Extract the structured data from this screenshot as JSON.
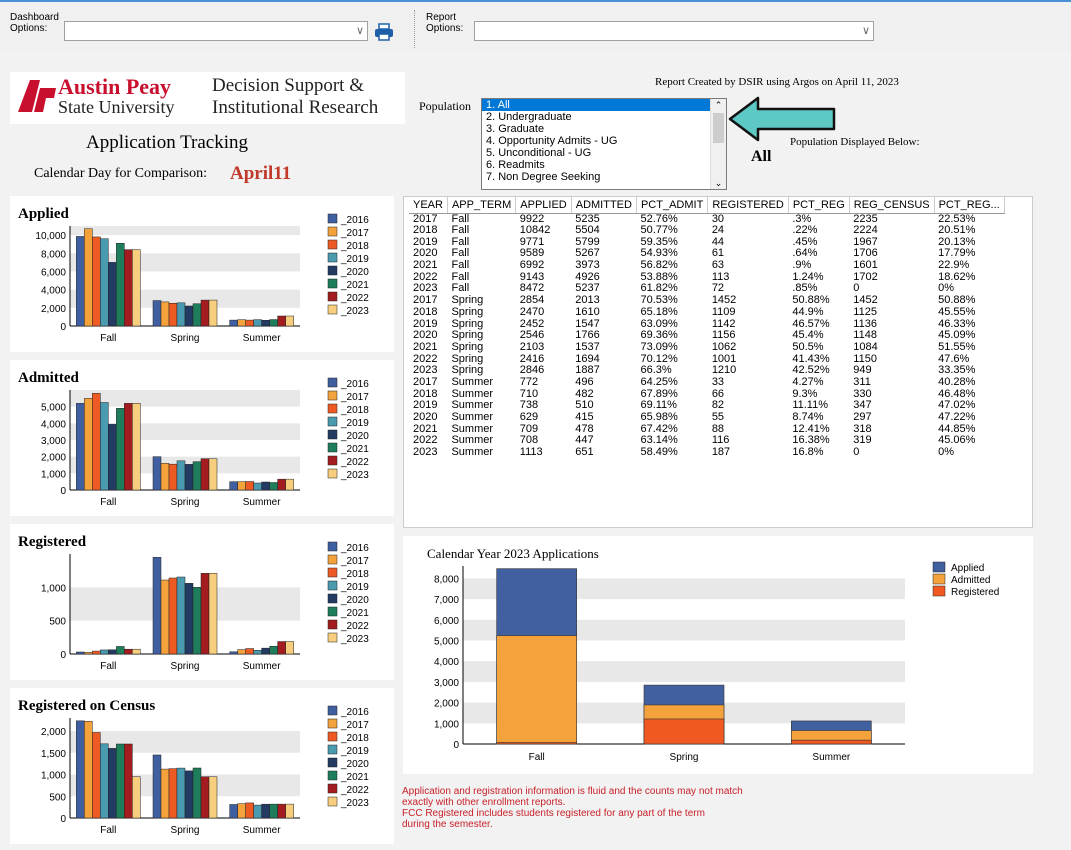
{
  "toolbar": {
    "dashboard_label_line1": "Dashboard",
    "dashboard_label_line2": "Options:",
    "report_label_line1": "Report",
    "report_label_line2": "Options:",
    "dashboard_value": "",
    "report_value": ""
  },
  "header": {
    "logo_austin": "Austin Peay",
    "logo_state": "State University",
    "logo_dept_line1": "Decision Support &",
    "logo_dept_line2": "Institutional Research",
    "title": "Application Tracking",
    "comparison_label": "Calendar Day for Comparison:",
    "comparison_value": "April11",
    "report_created": "Report Created by DSIR using Argos on April 11, 2023",
    "population_label": "Population",
    "population_displayed_label": "Population Displayed Below:",
    "population_displayed_value": "All"
  },
  "population_options": [
    "1. All",
    "2. Undergraduate",
    "3. Graduate",
    "4. Opportunity Admits - UG",
    "5. Unconditional - UG",
    "6. Readmits",
    "7. Non Degree Seeking"
  ],
  "population_selected": 0,
  "table": {
    "columns": [
      "YEAR",
      "APP_TERM",
      "APPLIED",
      "ADMITTED",
      "PCT_ADMIT",
      "REGISTERED",
      "PCT_REG",
      "REG_CENSUS",
      "PCT_REG..."
    ],
    "rows": [
      [
        "2017",
        "Fall",
        "9922",
        "5235",
        "52.76%",
        "30",
        ".3%",
        "2235",
        "22.53%"
      ],
      [
        "2018",
        "Fall",
        "10842",
        "5504",
        "50.77%",
        "24",
        ".22%",
        "2224",
        "20.51%"
      ],
      [
        "2019",
        "Fall",
        "9771",
        "5799",
        "59.35%",
        "44",
        ".45%",
        "1967",
        "20.13%"
      ],
      [
        "2020",
        "Fall",
        "9589",
        "5267",
        "54.93%",
        "61",
        ".64%",
        "1706",
        "17.79%"
      ],
      [
        "2021",
        "Fall",
        "6992",
        "3973",
        "56.82%",
        "63",
        ".9%",
        "1601",
        "22.9%"
      ],
      [
        "2022",
        "Fall",
        "9143",
        "4926",
        "53.88%",
        "113",
        "1.24%",
        "1702",
        "18.62%"
      ],
      [
        "2023",
        "Fall",
        "8472",
        "5237",
        "61.82%",
        "72",
        ".85%",
        "0",
        "0%"
      ],
      [
        "2017",
        "Spring",
        "2854",
        "2013",
        "70.53%",
        "1452",
        "50.88%",
        "1452",
        "50.88%"
      ],
      [
        "2018",
        "Spring",
        "2470",
        "1610",
        "65.18%",
        "1109",
        "44.9%",
        "1125",
        "45.55%"
      ],
      [
        "2019",
        "Spring",
        "2452",
        "1547",
        "63.09%",
        "1142",
        "46.57%",
        "1136",
        "46.33%"
      ],
      [
        "2020",
        "Spring",
        "2546",
        "1766",
        "69.36%",
        "1156",
        "45.4%",
        "1148",
        "45.09%"
      ],
      [
        "2021",
        "Spring",
        "2103",
        "1537",
        "73.09%",
        "1062",
        "50.5%",
        "1084",
        "51.55%"
      ],
      [
        "2022",
        "Spring",
        "2416",
        "1694",
        "70.12%",
        "1001",
        "41.43%",
        "1150",
        "47.6%"
      ],
      [
        "2023",
        "Spring",
        "2846",
        "1887",
        "66.3%",
        "1210",
        "42.52%",
        "949",
        "33.35%"
      ],
      [
        "2017",
        "Summer",
        "772",
        "496",
        "64.25%",
        "33",
        "4.27%",
        "311",
        "40.28%"
      ],
      [
        "2018",
        "Summer",
        "710",
        "482",
        "67.89%",
        "66",
        "9.3%",
        "330",
        "46.48%"
      ],
      [
        "2019",
        "Summer",
        "738",
        "510",
        "69.11%",
        "82",
        "11.11%",
        "347",
        "47.02%"
      ],
      [
        "2020",
        "Summer",
        "629",
        "415",
        "65.98%",
        "55",
        "8.74%",
        "297",
        "47.22%"
      ],
      [
        "2021",
        "Summer",
        "709",
        "478",
        "67.42%",
        "88",
        "12.41%",
        "318",
        "44.85%"
      ],
      [
        "2022",
        "Summer",
        "708",
        "447",
        "63.14%",
        "116",
        "16.38%",
        "319",
        "45.06%"
      ],
      [
        "2023",
        "Summer",
        "1113",
        "651",
        "58.49%",
        "187",
        "16.8%",
        "0",
        "0%"
      ]
    ]
  },
  "year_legend": [
    "_2016",
    "_2017",
    "_2018",
    "_2019",
    "_2020",
    "_2021",
    "_2022",
    "_2023"
  ],
  "year_colors": [
    "#3f5fa0",
    "#f3a23c",
    "#ee5a24",
    "#4a9ab0",
    "#233a63",
    "#1e7d5a",
    "#a31d20",
    "#f7ce7e"
  ],
  "chart_data": [
    {
      "type": "bar",
      "title": "Applied",
      "categories": [
        "Fall",
        "Spring",
        "Summer"
      ],
      "yticks": [
        "0",
        "2,000",
        "4,000",
        "6,000",
        "8,000",
        "10,000"
      ],
      "ylim": [
        0,
        11000
      ],
      "series": [
        {
          "name": "_2016",
          "values": [
            9850,
            2800,
            650
          ]
        },
        {
          "name": "_2017",
          "values": [
            10700,
            2650,
            700
          ]
        },
        {
          "name": "_2018",
          "values": [
            9800,
            2500,
            650
          ]
        },
        {
          "name": "_2019",
          "values": [
            9600,
            2550,
            700
          ]
        },
        {
          "name": "_2020",
          "values": [
            7000,
            2200,
            630
          ]
        },
        {
          "name": "_2021",
          "values": [
            9100,
            2450,
            710
          ]
        },
        {
          "name": "_2022",
          "values": [
            8400,
            2850,
            1100
          ]
        },
        {
          "name": "_2023",
          "values": [
            8400,
            2850,
            1100
          ]
        }
      ]
    },
    {
      "type": "bar",
      "title": "Admitted",
      "categories": [
        "Fall",
        "Spring",
        "Summer"
      ],
      "yticks": [
        "0",
        "1,000",
        "2,000",
        "3,000",
        "4,000",
        "5,000"
      ],
      "ylim": [
        0,
        6000
      ],
      "series": [
        {
          "name": "_2016",
          "values": [
            5200,
            2000,
            500
          ]
        },
        {
          "name": "_2017",
          "values": [
            5500,
            1600,
            500
          ]
        },
        {
          "name": "_2018",
          "values": [
            5800,
            1550,
            510
          ]
        },
        {
          "name": "_2019",
          "values": [
            5250,
            1750,
            420
          ]
        },
        {
          "name": "_2020",
          "values": [
            3950,
            1540,
            480
          ]
        },
        {
          "name": "_2021",
          "values": [
            4900,
            1700,
            450
          ]
        },
        {
          "name": "_2022",
          "values": [
            5200,
            1880,
            650
          ]
        },
        {
          "name": "_2023",
          "values": [
            5200,
            1880,
            650
          ]
        }
      ]
    },
    {
      "type": "bar",
      "title": "Registered",
      "categories": [
        "Fall",
        "Spring",
        "Summer"
      ],
      "yticks": [
        "0",
        "500",
        "1,000"
      ],
      "ylim": [
        0,
        1500
      ],
      "series": [
        {
          "name": "_2016",
          "values": [
            30,
            1450,
            33
          ]
        },
        {
          "name": "_2017",
          "values": [
            24,
            1110,
            66
          ]
        },
        {
          "name": "_2018",
          "values": [
            44,
            1140,
            82
          ]
        },
        {
          "name": "_2019",
          "values": [
            61,
            1155,
            55
          ]
        },
        {
          "name": "_2020",
          "values": [
            63,
            1060,
            88
          ]
        },
        {
          "name": "_2021",
          "values": [
            113,
            1000,
            116
          ]
        },
        {
          "name": "_2022",
          "values": [
            72,
            1210,
            187
          ]
        },
        {
          "name": "_2023",
          "values": [
            72,
            1210,
            187
          ]
        }
      ]
    },
    {
      "type": "bar",
      "title": "Registered on Census",
      "categories": [
        "Fall",
        "Spring",
        "Summer"
      ],
      "yticks": [
        "0",
        "500",
        "1,000",
        "1,500",
        "2,000"
      ],
      "ylim": [
        0,
        2300
      ],
      "series": [
        {
          "name": "_2016",
          "values": [
            2235,
            1450,
            311
          ]
        },
        {
          "name": "_2017",
          "values": [
            2224,
            1125,
            330
          ]
        },
        {
          "name": "_2018",
          "values": [
            1967,
            1136,
            347
          ]
        },
        {
          "name": "_2019",
          "values": [
            1706,
            1148,
            297
          ]
        },
        {
          "name": "_2020",
          "values": [
            1601,
            1084,
            318
          ]
        },
        {
          "name": "_2021",
          "values": [
            1702,
            1150,
            319
          ]
        },
        {
          "name": "_2022",
          "values": [
            1702,
            949,
            319
          ]
        },
        {
          "name": "_2023",
          "values": [
            949,
            949,
            319
          ]
        }
      ]
    },
    {
      "type": "bar",
      "stacked": true,
      "title": "Calendar Year 2023 Applications",
      "categories": [
        "Fall",
        "Spring",
        "Summer"
      ],
      "yticks": [
        "0",
        "1,000",
        "2,000",
        "3,000",
        "4,000",
        "5,000",
        "6,000",
        "7,000",
        "8,000"
      ],
      "ylim": [
        0,
        8600
      ],
      "series": [
        {
          "name": "Applied",
          "values": [
            8472,
            2846,
            1113
          ]
        },
        {
          "name": "Admitted",
          "values": [
            5237,
            1887,
            651
          ]
        },
        {
          "name": "Registered",
          "values": [
            72,
            1210,
            187
          ]
        }
      ],
      "colors": [
        "#4060a0",
        "#f3a23c",
        "#f05a22"
      ]
    }
  ],
  "footnote": [
    "Application and registration information is fluid and the counts may not match",
    "exactly with other enrollment reports.",
    "FCC Registered includes students registered for any part of the term",
    "during the semester."
  ]
}
